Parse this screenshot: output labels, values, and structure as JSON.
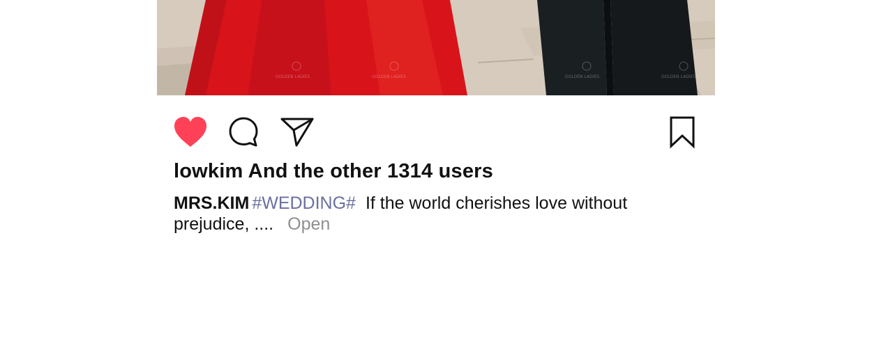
{
  "photo": {
    "watermark_text": "GOLDEN LADIES"
  },
  "actions": {
    "like_icon": "heart-icon",
    "comment_icon": "comment-icon",
    "share_icon": "send-icon",
    "save_icon": "bookmark-icon",
    "like_color": "#ff4157"
  },
  "likes": {
    "text": "lowkim And the other 1314 users"
  },
  "caption": {
    "author": "MRS.KIM",
    "hashtag": "#WEDDING#",
    "text": "If the world cherishes love without prejudice, ....",
    "more_label": "Open",
    "hashtag_color": "#6a6f9e"
  }
}
